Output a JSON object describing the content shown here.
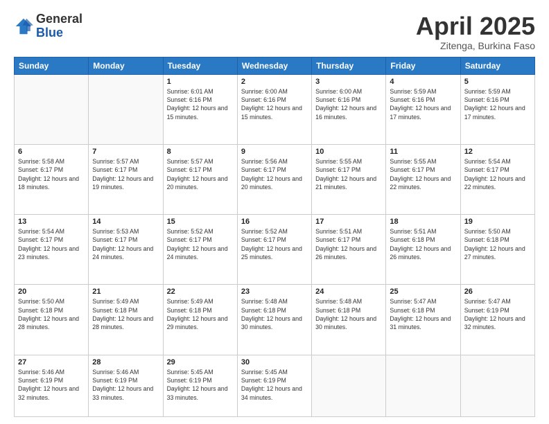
{
  "logo": {
    "general": "General",
    "blue": "Blue"
  },
  "title": "April 2025",
  "subtitle": "Zitenga, Burkina Faso",
  "weekdays": [
    "Sunday",
    "Monday",
    "Tuesday",
    "Wednesday",
    "Thursday",
    "Friday",
    "Saturday"
  ],
  "weeks": [
    [
      {
        "day": "",
        "info": ""
      },
      {
        "day": "",
        "info": ""
      },
      {
        "day": "1",
        "info": "Sunrise: 6:01 AM\nSunset: 6:16 PM\nDaylight: 12 hours and 15 minutes."
      },
      {
        "day": "2",
        "info": "Sunrise: 6:00 AM\nSunset: 6:16 PM\nDaylight: 12 hours and 15 minutes."
      },
      {
        "day": "3",
        "info": "Sunrise: 6:00 AM\nSunset: 6:16 PM\nDaylight: 12 hours and 16 minutes."
      },
      {
        "day": "4",
        "info": "Sunrise: 5:59 AM\nSunset: 6:16 PM\nDaylight: 12 hours and 17 minutes."
      },
      {
        "day": "5",
        "info": "Sunrise: 5:59 AM\nSunset: 6:16 PM\nDaylight: 12 hours and 17 minutes."
      }
    ],
    [
      {
        "day": "6",
        "info": "Sunrise: 5:58 AM\nSunset: 6:17 PM\nDaylight: 12 hours and 18 minutes."
      },
      {
        "day": "7",
        "info": "Sunrise: 5:57 AM\nSunset: 6:17 PM\nDaylight: 12 hours and 19 minutes."
      },
      {
        "day": "8",
        "info": "Sunrise: 5:57 AM\nSunset: 6:17 PM\nDaylight: 12 hours and 20 minutes."
      },
      {
        "day": "9",
        "info": "Sunrise: 5:56 AM\nSunset: 6:17 PM\nDaylight: 12 hours and 20 minutes."
      },
      {
        "day": "10",
        "info": "Sunrise: 5:55 AM\nSunset: 6:17 PM\nDaylight: 12 hours and 21 minutes."
      },
      {
        "day": "11",
        "info": "Sunrise: 5:55 AM\nSunset: 6:17 PM\nDaylight: 12 hours and 22 minutes."
      },
      {
        "day": "12",
        "info": "Sunrise: 5:54 AM\nSunset: 6:17 PM\nDaylight: 12 hours and 22 minutes."
      }
    ],
    [
      {
        "day": "13",
        "info": "Sunrise: 5:54 AM\nSunset: 6:17 PM\nDaylight: 12 hours and 23 minutes."
      },
      {
        "day": "14",
        "info": "Sunrise: 5:53 AM\nSunset: 6:17 PM\nDaylight: 12 hours and 24 minutes."
      },
      {
        "day": "15",
        "info": "Sunrise: 5:52 AM\nSunset: 6:17 PM\nDaylight: 12 hours and 24 minutes."
      },
      {
        "day": "16",
        "info": "Sunrise: 5:52 AM\nSunset: 6:17 PM\nDaylight: 12 hours and 25 minutes."
      },
      {
        "day": "17",
        "info": "Sunrise: 5:51 AM\nSunset: 6:17 PM\nDaylight: 12 hours and 26 minutes."
      },
      {
        "day": "18",
        "info": "Sunrise: 5:51 AM\nSunset: 6:18 PM\nDaylight: 12 hours and 26 minutes."
      },
      {
        "day": "19",
        "info": "Sunrise: 5:50 AM\nSunset: 6:18 PM\nDaylight: 12 hours and 27 minutes."
      }
    ],
    [
      {
        "day": "20",
        "info": "Sunrise: 5:50 AM\nSunset: 6:18 PM\nDaylight: 12 hours and 28 minutes."
      },
      {
        "day": "21",
        "info": "Sunrise: 5:49 AM\nSunset: 6:18 PM\nDaylight: 12 hours and 28 minutes."
      },
      {
        "day": "22",
        "info": "Sunrise: 5:49 AM\nSunset: 6:18 PM\nDaylight: 12 hours and 29 minutes."
      },
      {
        "day": "23",
        "info": "Sunrise: 5:48 AM\nSunset: 6:18 PM\nDaylight: 12 hours and 30 minutes."
      },
      {
        "day": "24",
        "info": "Sunrise: 5:48 AM\nSunset: 6:18 PM\nDaylight: 12 hours and 30 minutes."
      },
      {
        "day": "25",
        "info": "Sunrise: 5:47 AM\nSunset: 6:18 PM\nDaylight: 12 hours and 31 minutes."
      },
      {
        "day": "26",
        "info": "Sunrise: 5:47 AM\nSunset: 6:19 PM\nDaylight: 12 hours and 32 minutes."
      }
    ],
    [
      {
        "day": "27",
        "info": "Sunrise: 5:46 AM\nSunset: 6:19 PM\nDaylight: 12 hours and 32 minutes."
      },
      {
        "day": "28",
        "info": "Sunrise: 5:46 AM\nSunset: 6:19 PM\nDaylight: 12 hours and 33 minutes."
      },
      {
        "day": "29",
        "info": "Sunrise: 5:45 AM\nSunset: 6:19 PM\nDaylight: 12 hours and 33 minutes."
      },
      {
        "day": "30",
        "info": "Sunrise: 5:45 AM\nSunset: 6:19 PM\nDaylight: 12 hours and 34 minutes."
      },
      {
        "day": "",
        "info": ""
      },
      {
        "day": "",
        "info": ""
      },
      {
        "day": "",
        "info": ""
      }
    ]
  ]
}
